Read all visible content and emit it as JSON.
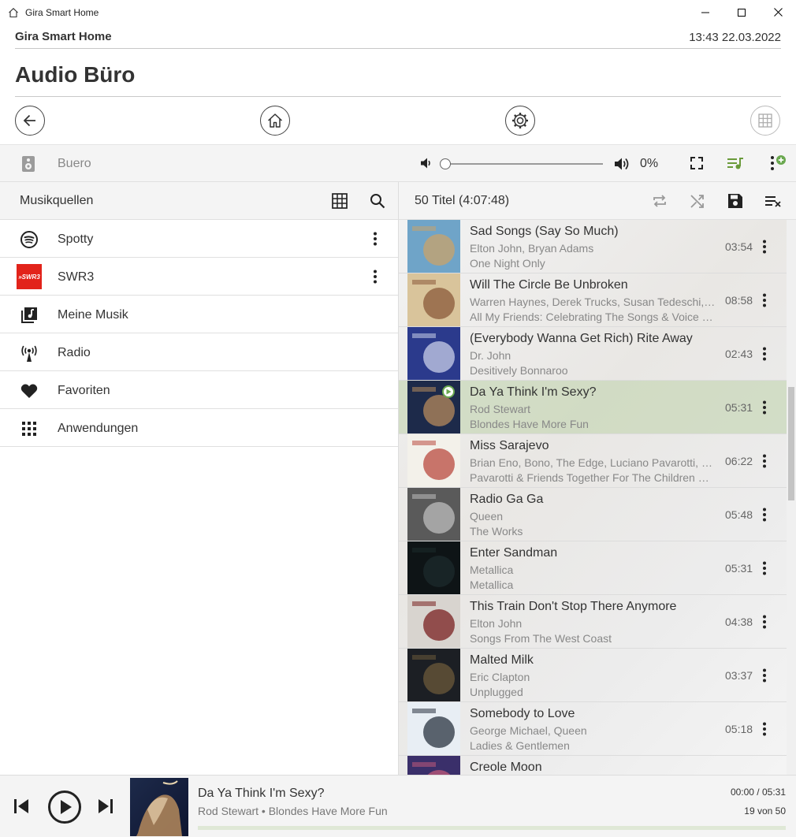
{
  "window": {
    "title": "Gira Smart Home"
  },
  "header": {
    "app_name": "Gira Smart Home",
    "datetime": "13:43 22.03.2022"
  },
  "page": {
    "title": "Audio Büro"
  },
  "player": {
    "zone": "Buero",
    "volume_label": "0%",
    "volume_level": 0
  },
  "sources": {
    "title": "Musikquellen",
    "items": [
      {
        "label": "Spotty",
        "icon": "spotify-icon",
        "has_menu": true
      },
      {
        "label": "SWR3",
        "icon": "swr3-logo",
        "logo_text": "»SWR3",
        "has_menu": true
      },
      {
        "label": "Meine Musik",
        "icon": "music-library-icon",
        "has_menu": false
      },
      {
        "label": "Radio",
        "icon": "radio-antenna-icon",
        "has_menu": false
      },
      {
        "label": "Favoriten",
        "icon": "heart-icon",
        "has_menu": false
      },
      {
        "label": "Anwendungen",
        "icon": "apps-grid-icon",
        "has_menu": false
      }
    ]
  },
  "queue": {
    "summary": "50 Titel (4:07:48)",
    "tracks": [
      {
        "title": "Sad Songs (Say So Much)",
        "artist": "Elton John, Bryan Adams",
        "album": "One Night Only",
        "duration": "03:54",
        "cover_colors": [
          "#6fa4c8",
          "#c9a36a"
        ]
      },
      {
        "title": "Will The Circle Be Unbroken",
        "artist": "Warren Haynes, Derek Trucks, Susan Tedeschi, Dave…",
        "album": "All My Friends: Celebrating The Songs & Voice Of Gregg…",
        "duration": "08:58",
        "cover_colors": [
          "#d9c49b",
          "#8a5a3a"
        ]
      },
      {
        "title": "(Everybody Wanna Get Rich) Rite Away",
        "artist": "Dr. John",
        "album": "Desitively Bonnaroo",
        "duration": "02:43",
        "cover_colors": [
          "#2b3a8c",
          "#c9cfe8"
        ]
      },
      {
        "title": "Da Ya Think I'm Sexy?",
        "artist": "Rod Stewart",
        "album": "Blondes Have More Fun",
        "duration": "05:31",
        "cover_colors": [
          "#1d2a4a",
          "#b58a5c"
        ],
        "playing": true
      },
      {
        "title": "Miss Sarajevo",
        "artist": "Brian Eno, Bono, The Edge, Luciano Pavarotti, Orches…",
        "album": "Pavarotti & Friends Together For The Children Of Bosnia",
        "duration": "06:22",
        "cover_colors": [
          "#f3f1ea",
          "#b94a3f"
        ]
      },
      {
        "title": "Radio Ga Ga",
        "artist": "Queen",
        "album": "The Works",
        "duration": "05:48",
        "cover_colors": [
          "#5a5a5a",
          "#bdbdbd"
        ]
      },
      {
        "title": "Enter Sandman",
        "artist": "Metallica",
        "album": "Metallica",
        "duration": "05:31",
        "cover_colors": [
          "#0e1416",
          "#1c2a2c"
        ]
      },
      {
        "title": "This Train Don't Stop There Anymore",
        "artist": "Elton John",
        "album": "Songs From The West Coast",
        "duration": "04:38",
        "cover_colors": [
          "#d8d4cf",
          "#7a2020"
        ]
      },
      {
        "title": "Malted Milk",
        "artist": "Eric Clapton",
        "album": "Unplugged",
        "duration": "03:37",
        "cover_colors": [
          "#1c1f24",
          "#6b5a3a"
        ]
      },
      {
        "title": "Somebody to Love",
        "artist": "George Michael, Queen",
        "album": "Ladies & Gentlemen",
        "duration": "05:18",
        "cover_colors": [
          "#e8eef4",
          "#2a3340"
        ]
      },
      {
        "title": "Creole Moon",
        "artist": "",
        "album": "",
        "duration": "",
        "cover_colors": [
          "#3a2f6a",
          "#c05a7a"
        ]
      }
    ]
  },
  "now_playing": {
    "title": "Da Ya Think I'm Sexy?",
    "subtitle": "Rod Stewart • Blondes Have More Fun",
    "time": "00:00 / 05:31",
    "position": "19 von 50",
    "progress": 0.0
  },
  "colors": {
    "accent": "#8fbb6f",
    "playing_row": "#c9d8bb",
    "swr3_red": "#e2231a"
  }
}
